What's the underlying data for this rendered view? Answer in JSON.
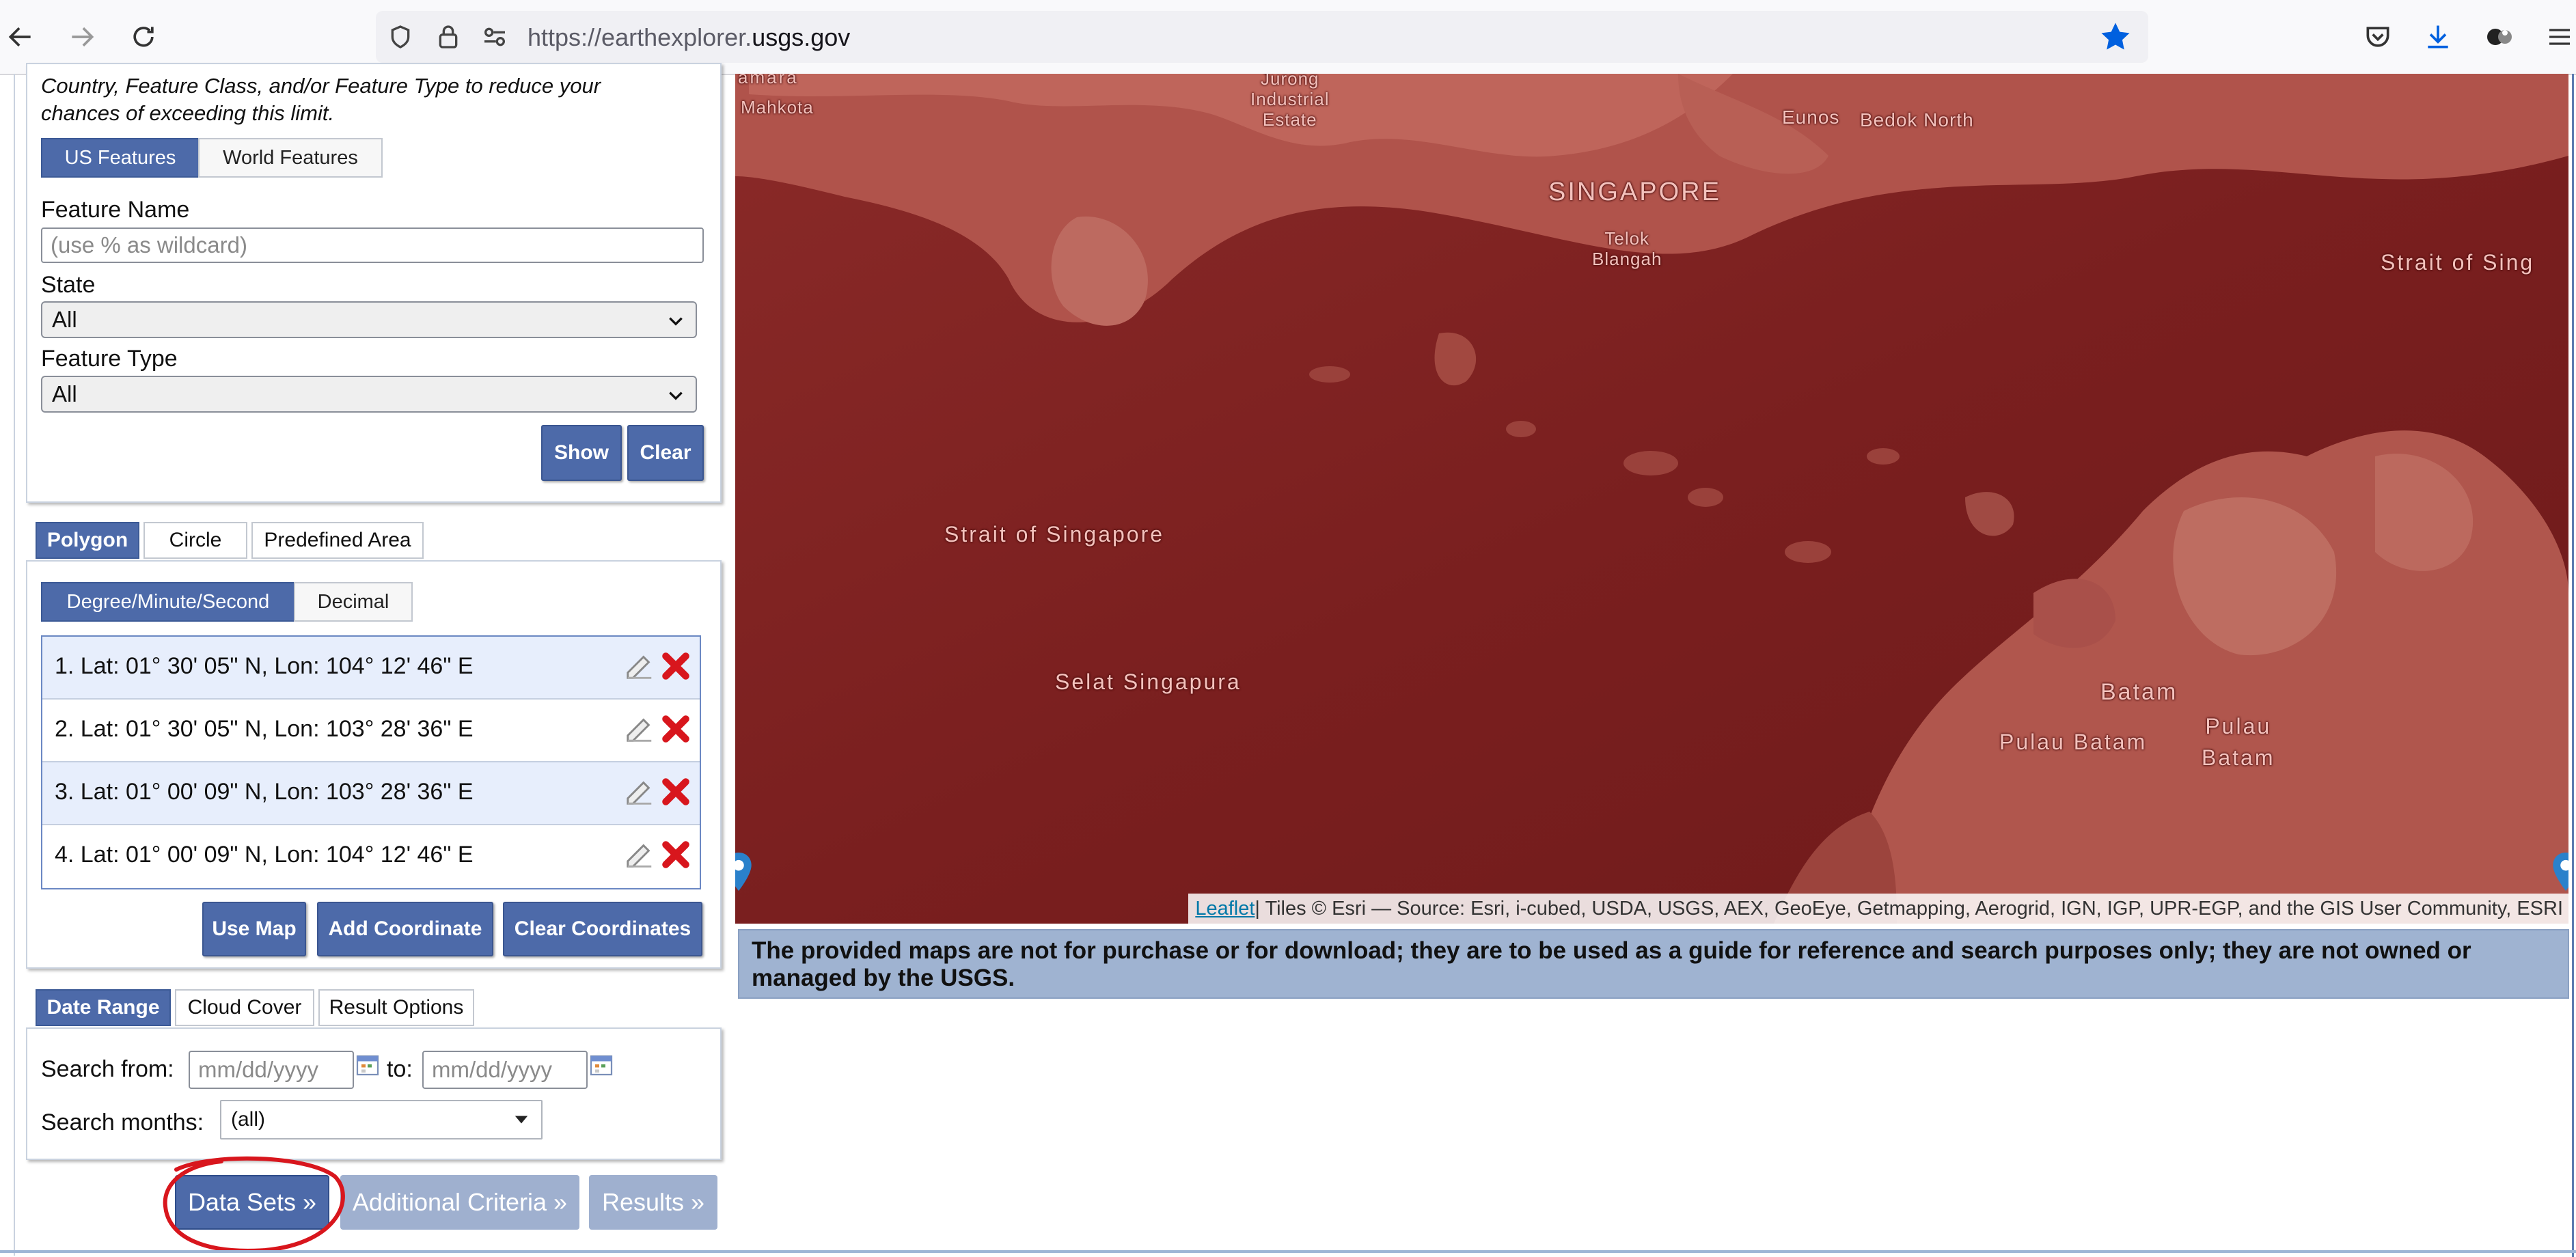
{
  "browser": {
    "url_prefix": "https://earthexplorer.",
    "url_domain": "usgs.gov",
    "icons": [
      "back-icon",
      "forward-icon",
      "reload-icon",
      "shield-icon",
      "lock-icon",
      "permissions-icon",
      "bookmark-star-icon",
      "pocket-icon",
      "download-icon",
      "extensions-icon",
      "menu-icon"
    ],
    "accent": "#0060df"
  },
  "feature_search": {
    "note": "Country, Feature Class, and/or Feature Type to reduce your chances of exceeding this limit.",
    "tabs": [
      "US Features",
      "World Features"
    ],
    "feature_name_label": "Feature Name",
    "feature_name_placeholder": "(use % as wildcard)",
    "state_label": "State",
    "state_value": "All",
    "feature_type_label": "Feature Type",
    "feature_type_value": "All",
    "show_label": "Show",
    "clear_label": "Clear"
  },
  "area_tabs": [
    "Polygon",
    "Circle",
    "Predefined Area"
  ],
  "coord_format_tabs": [
    "Degree/Minute/Second",
    "Decimal"
  ],
  "coordinates": [
    "1.  Lat: 01° 30' 05\" N, Lon: 104° 12' 46\" E",
    "2.  Lat: 01° 30' 05\" N, Lon: 103° 28' 36\" E",
    "3.  Lat: 01° 00' 09\" N, Lon: 103° 28' 36\" E",
    "4.  Lat: 01° 00' 09\" N, Lon: 104° 12' 46\" E"
  ],
  "coord_buttons": {
    "use_map": "Use Map",
    "add": "Add Coordinate",
    "clear": "Clear Coordinates"
  },
  "date_tabs": [
    "Date Range",
    "Cloud Cover",
    "Result Options"
  ],
  "date_range": {
    "from_label": "Search from:",
    "from_placeholder": "mm/dd/yyyy",
    "to_label": "to:",
    "to_placeholder": "mm/dd/yyyy",
    "months_label": "Search months:",
    "months_value": "(all)"
  },
  "steps": {
    "data_sets": "Data Sets »",
    "additional": "Additional Criteria »",
    "results": "Results »"
  },
  "map": {
    "labels": {
      "jurong": "Jurong\nIndustrial\nEstate",
      "mahkota": "Mahkota",
      "amara": "amara",
      "eunos": "Eunos",
      "bedok": "Bedok North",
      "singapore": "SINGAPORE",
      "telok": "Telok\nBlangah",
      "strait_right": "Strait  of  Sing",
      "strait_left": "Strait  of  Singapore",
      "selat": "Selat  Singapura",
      "batam": "Batam",
      "pulau_batam": "Pulau Batam",
      "pulau_batam2": "Pulau\nBatam"
    },
    "attribution_link": "Leaflet",
    "attribution_text": " | Tiles © Esri — Source: Esri, i-cubed, USDA, USGS, AEX, GeoEye, Getmapping, Aerogrid, IGN, IGP, UPR-EGP, and the GIS User Community, ESRI"
  },
  "disclaimer": "The provided maps are not for purchase or for download; they are to be used as a guide for reference and search purposes only; they are not owned or managed by the USGS.",
  "colors": {
    "primary_button": "#4d6aa9",
    "disabled_button": "#9fb0cf",
    "map_tint": "#7a1f1f",
    "annotation_red": "#d8161d"
  }
}
